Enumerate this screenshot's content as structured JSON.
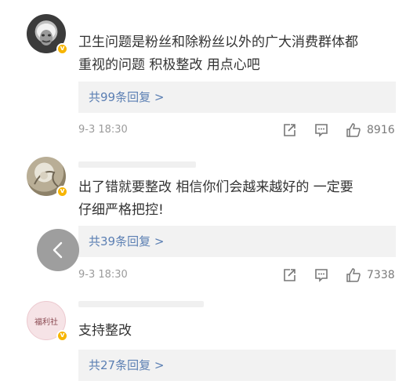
{
  "comments": [
    {
      "text_line1": "卫生问题是粉丝和除粉丝以外的广大消费群体都",
      "text_line2": "重视的问题 积极整改 用点心吧",
      "replies_label": "共99条回复 >",
      "time": "9-3 18:30",
      "likes": "8916"
    },
    {
      "text_line1": "出了错就要整改  相信你们会越来越好的  一定要",
      "text_line2": "仔细严格把控!",
      "replies_label": "共39条回复 >",
      "time": "9-3 18:30",
      "likes": "7338"
    },
    {
      "text_line1": "支持整改",
      "replies_label": "共27条回复 >",
      "avatar_text": "福利社"
    }
  ],
  "colors": {
    "reply_link": "#5b7fb3",
    "reply_bg": "#f2f2f2",
    "verified_badge": "#f7b500",
    "meta_gray": "#9b9b9b"
  },
  "icons": [
    "share-icon",
    "comment-icon",
    "like-icon",
    "back-chevron-icon"
  ]
}
